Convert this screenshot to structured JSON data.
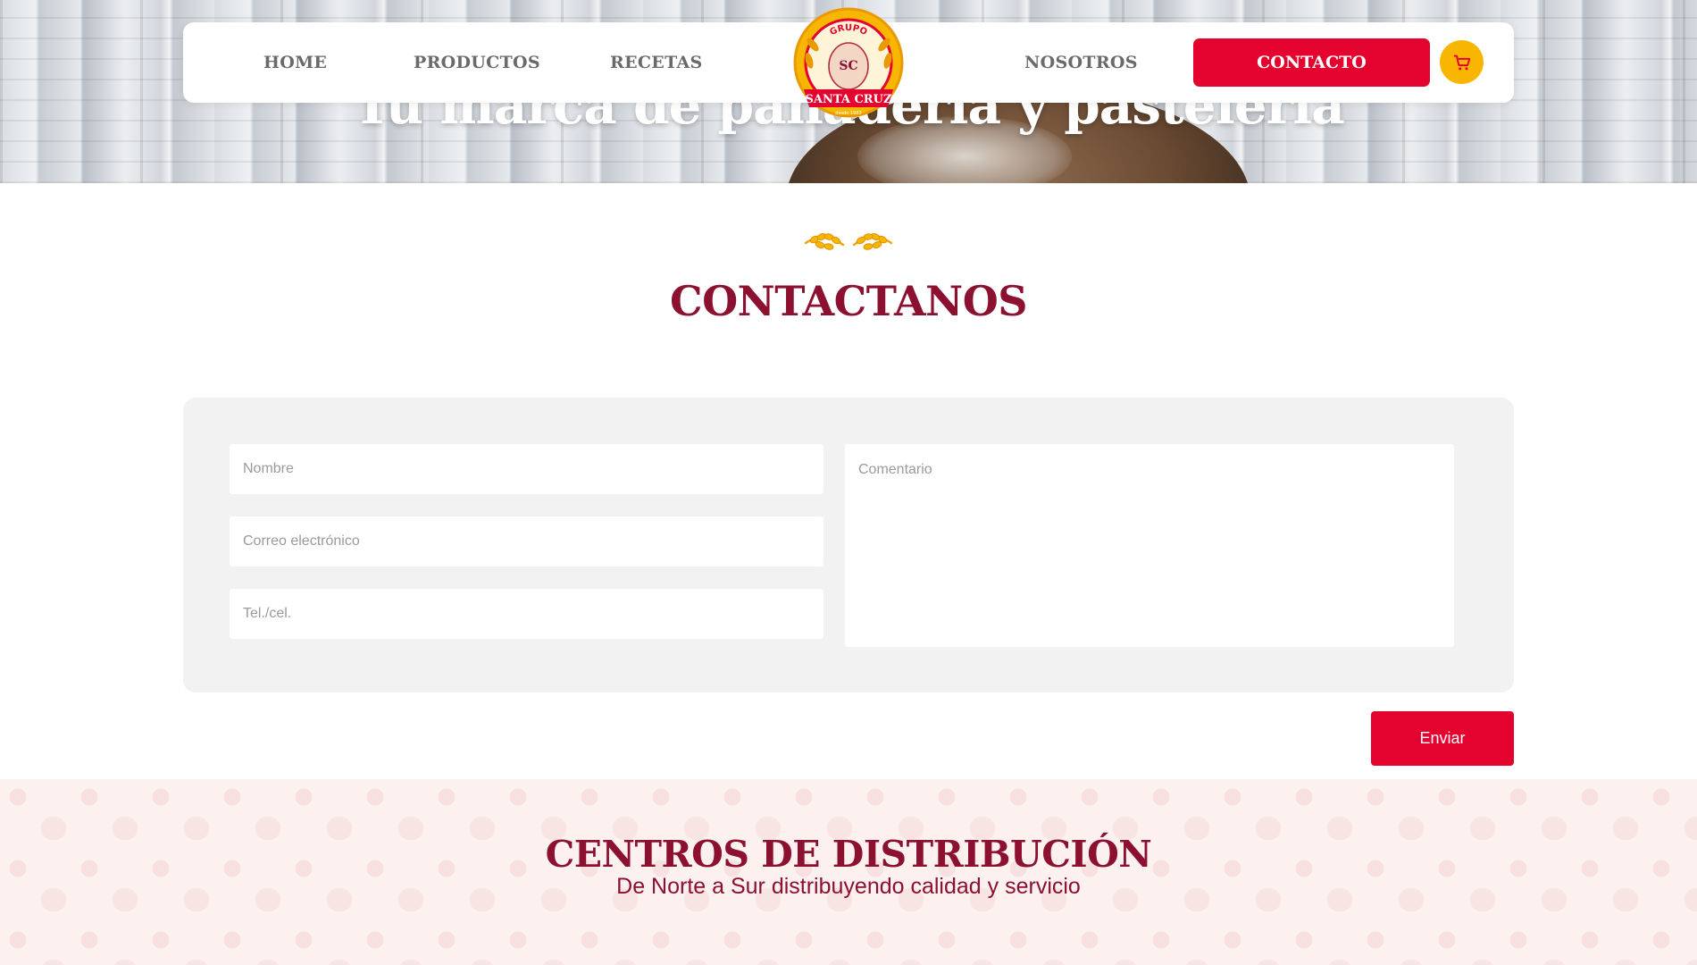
{
  "hero": {
    "title": "Tu marca de panadería y pastelería"
  },
  "nav": {
    "home": "HOME",
    "productos": "PRODUCTOS",
    "recetas": "RECETAS",
    "nosotros": "NOSOTROS",
    "contacto": "CONTACTO",
    "cart_icon": "shopping-cart-icon"
  },
  "logo": {
    "top": "GRUPO",
    "monogram": "SC",
    "banner": "SANTA CRUZ",
    "bottom": "desde 1983"
  },
  "section": {
    "title": "CONTACTANOS",
    "ornament_icon": "wheat-icon"
  },
  "form": {
    "name_placeholder": "Nombre",
    "email_placeholder": "Correo electrónico",
    "phone_placeholder": "Tel./cel.",
    "comment_placeholder": "Comentario",
    "submit_label": "Enviar"
  },
  "distribution": {
    "title": "CENTROS DE DISTRIBUCIÓN",
    "subtitle": "De Norte a Sur distribuyendo calidad y servicio"
  },
  "colors": {
    "brand_red": "#e4032e",
    "title_maroon": "#8c1030",
    "accent_yellow": "#f8b600",
    "panel_gray": "#f2f2f2"
  }
}
